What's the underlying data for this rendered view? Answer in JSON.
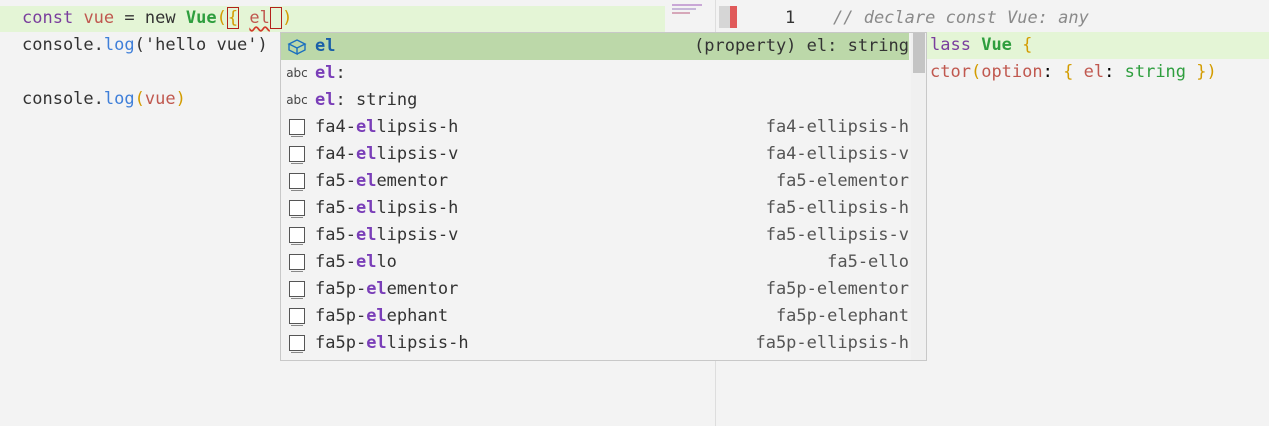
{
  "editor": {
    "line1": {
      "kw_const": "const",
      "var_name": "vue",
      "op_eq": "=",
      "kw_new": "new",
      "class_name": "Vue",
      "open_paren": "(",
      "open_brace": "{",
      "prop": "el",
      "close_paren": ")"
    },
    "line2": {
      "obj": "console",
      "dot": ".",
      "method": "log",
      "open": "(",
      "arg": "'hello vue'",
      "close": ")"
    },
    "line4": {
      "obj": "console",
      "dot": ".",
      "method": "log",
      "open": "(",
      "arg": "vue",
      "close": ")"
    }
  },
  "peek": {
    "line_number": "1",
    "comment": "// declare const Vue: any",
    "line2": {
      "kw": "lass",
      "name": "Vue",
      "brace": "{"
    },
    "line3": {
      "ctor": "ctor",
      "open": "(",
      "param": "option",
      "colon": ":",
      "obrace": "{",
      "prop": "el",
      "colon2": ":",
      "type": "string",
      "cbrace": "}",
      "close": ")"
    }
  },
  "suggest": {
    "items": [
      {
        "icon": "property-cube-icon",
        "label_hl": "el",
        "label_rest": "",
        "detail": "(property) el: string",
        "selected": true
      },
      {
        "icon": "abc-text-icon",
        "icon_text": "abc",
        "label_hl": "el",
        "label_rest": ":",
        "detail": ""
      },
      {
        "icon": "abc-text-icon",
        "icon_text": "abc",
        "label_hl": "el",
        "label_rest": ": string",
        "detail": ""
      },
      {
        "icon": "snippet-square-icon",
        "label_pre": "fa4-",
        "label_hl": "el",
        "label_rest": "lipsis-h",
        "detail": "fa4-ellipsis-h"
      },
      {
        "icon": "snippet-square-icon",
        "label_pre": "fa4-",
        "label_hl": "el",
        "label_rest": "lipsis-v",
        "detail": "fa4-ellipsis-v"
      },
      {
        "icon": "snippet-square-icon",
        "label_pre": "fa5-",
        "label_hl": "el",
        "label_rest": "ementor",
        "detail": "fa5-elementor"
      },
      {
        "icon": "snippet-square-icon",
        "label_pre": "fa5-",
        "label_hl": "el",
        "label_rest": "lipsis-h",
        "detail": "fa5-ellipsis-h"
      },
      {
        "icon": "snippet-square-icon",
        "label_pre": "fa5-",
        "label_hl": "el",
        "label_rest": "lipsis-v",
        "detail": "fa5-ellipsis-v"
      },
      {
        "icon": "snippet-square-icon",
        "label_pre": "fa5-",
        "label_hl": "el",
        "label_rest": "lo",
        "detail": "fa5-ello"
      },
      {
        "icon": "snippet-square-icon",
        "label_pre": "fa5p-",
        "label_hl": "el",
        "label_rest": "ementor",
        "detail": "fa5p-elementor"
      },
      {
        "icon": "snippet-square-icon",
        "label_pre": "fa5p-",
        "label_hl": "el",
        "label_rest": "ephant",
        "detail": "fa5p-elephant"
      },
      {
        "icon": "snippet-square-icon",
        "label_pre": "fa5p-",
        "label_hl": "el",
        "label_rest": "lipsis-h",
        "detail": "fa5p-ellipsis-h"
      }
    ]
  },
  "colors": {
    "current_line": "#e4f5d6",
    "selected_suggestion": "#bcd8a9",
    "keyword": "#7a3e9d",
    "class": "#2e9e3e",
    "function": "#3f7fd9",
    "match_highlight": "#7a3eb8"
  }
}
